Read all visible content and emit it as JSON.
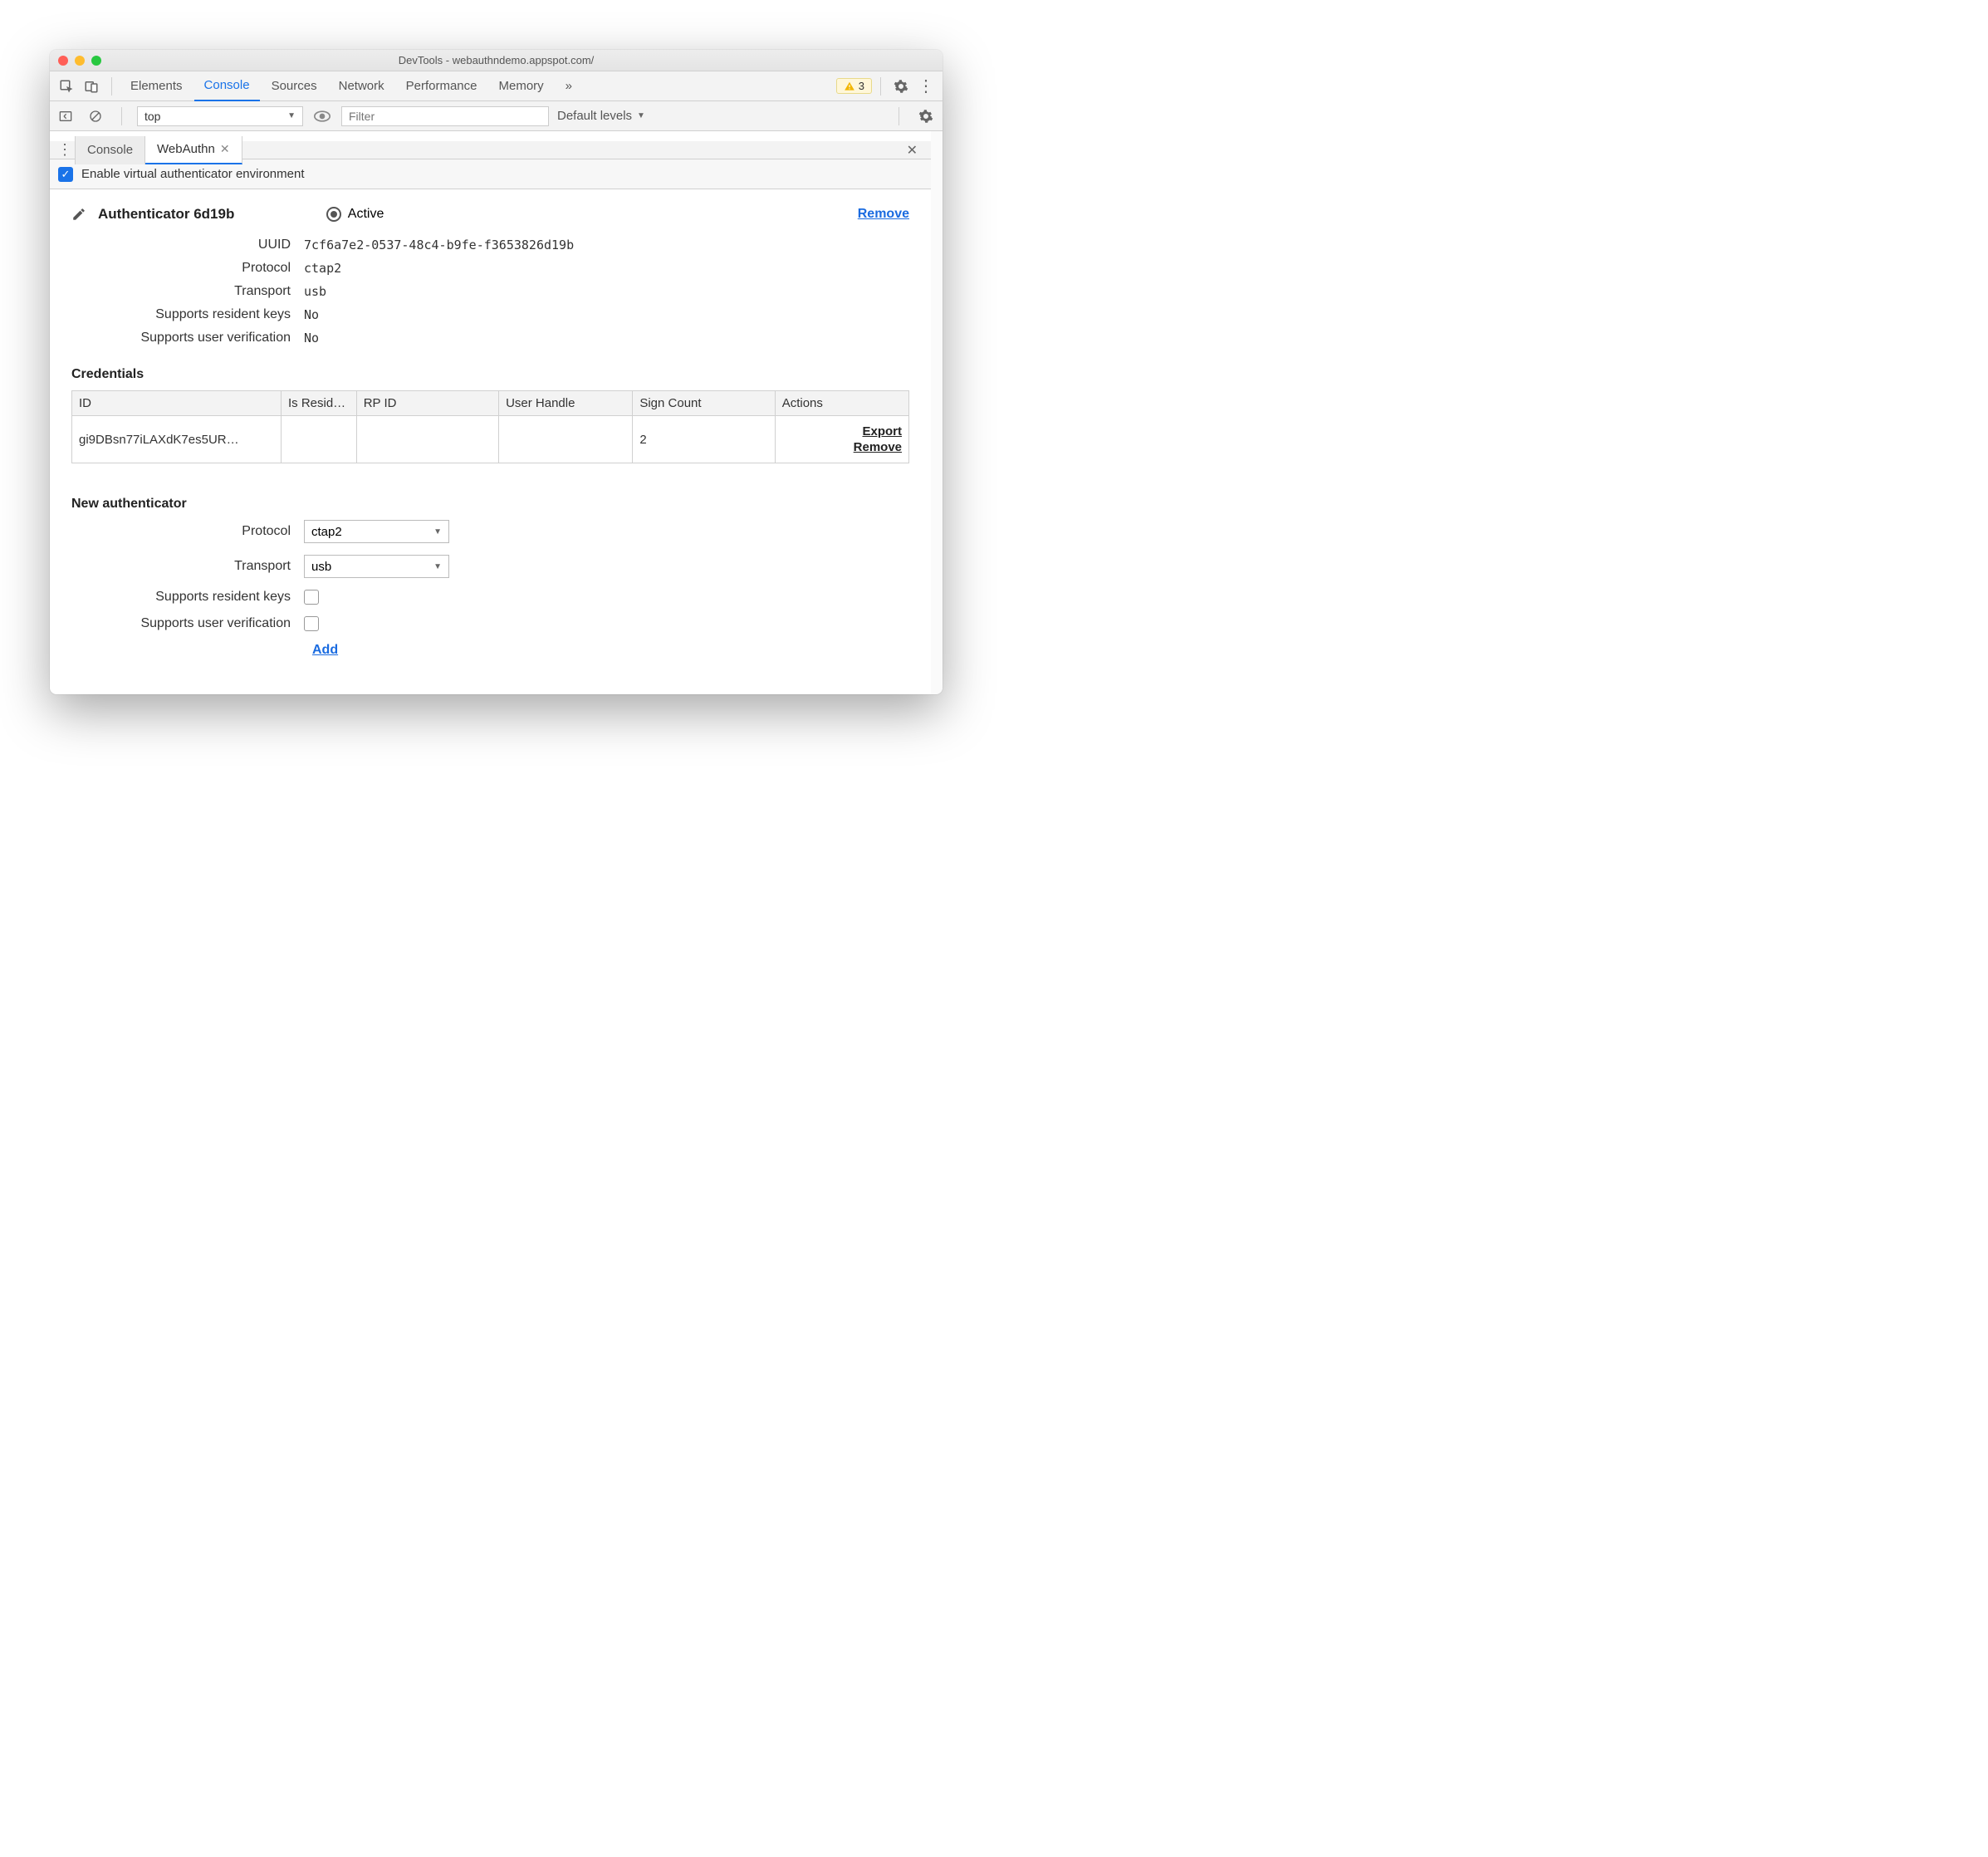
{
  "window": {
    "title": "DevTools - webauthndemo.appspot.com/"
  },
  "maintabs": {
    "items": [
      "Elements",
      "Console",
      "Sources",
      "Network",
      "Performance",
      "Memory"
    ],
    "active": "Console",
    "overflow": "»",
    "warning_count": "3"
  },
  "consolebar": {
    "context": "top",
    "filter_placeholder": "Filter",
    "levels_label": "Default levels"
  },
  "drawer": {
    "tabs": [
      {
        "label": "Console",
        "active": false,
        "closable": false
      },
      {
        "label": "WebAuthn",
        "active": true,
        "closable": true
      }
    ]
  },
  "enable": {
    "label": "Enable virtual authenticator environment",
    "checked": true
  },
  "authenticator": {
    "title": "Authenticator 6d19b",
    "active_label": "Active",
    "remove_label": "Remove",
    "props": {
      "uuid_label": "UUID",
      "uuid": "7cf6a7e2-0537-48c4-b9fe-f3653826d19b",
      "protocol_label": "Protocol",
      "protocol": "ctap2",
      "transport_label": "Transport",
      "transport": "usb",
      "resident_label": "Supports resident keys",
      "resident": "No",
      "verify_label": "Supports user verification",
      "verify": "No"
    }
  },
  "credentials": {
    "heading": "Credentials",
    "headers": {
      "id": "ID",
      "resident": "Is Resid…",
      "rp": "RP ID",
      "user": "User Handle",
      "count": "Sign Count",
      "actions": "Actions"
    },
    "rows": [
      {
        "id": "gi9DBsn77iLAXdK7es5UR…",
        "resident": "",
        "rp": "",
        "user": "",
        "count": "2"
      }
    ],
    "export_label": "Export",
    "remove_label": "Remove"
  },
  "newauth": {
    "heading": "New authenticator",
    "protocol_label": "Protocol",
    "protocol_value": "ctap2",
    "transport_label": "Transport",
    "transport_value": "usb",
    "resident_label": "Supports resident keys",
    "verify_label": "Supports user verification",
    "add_label": "Add"
  }
}
